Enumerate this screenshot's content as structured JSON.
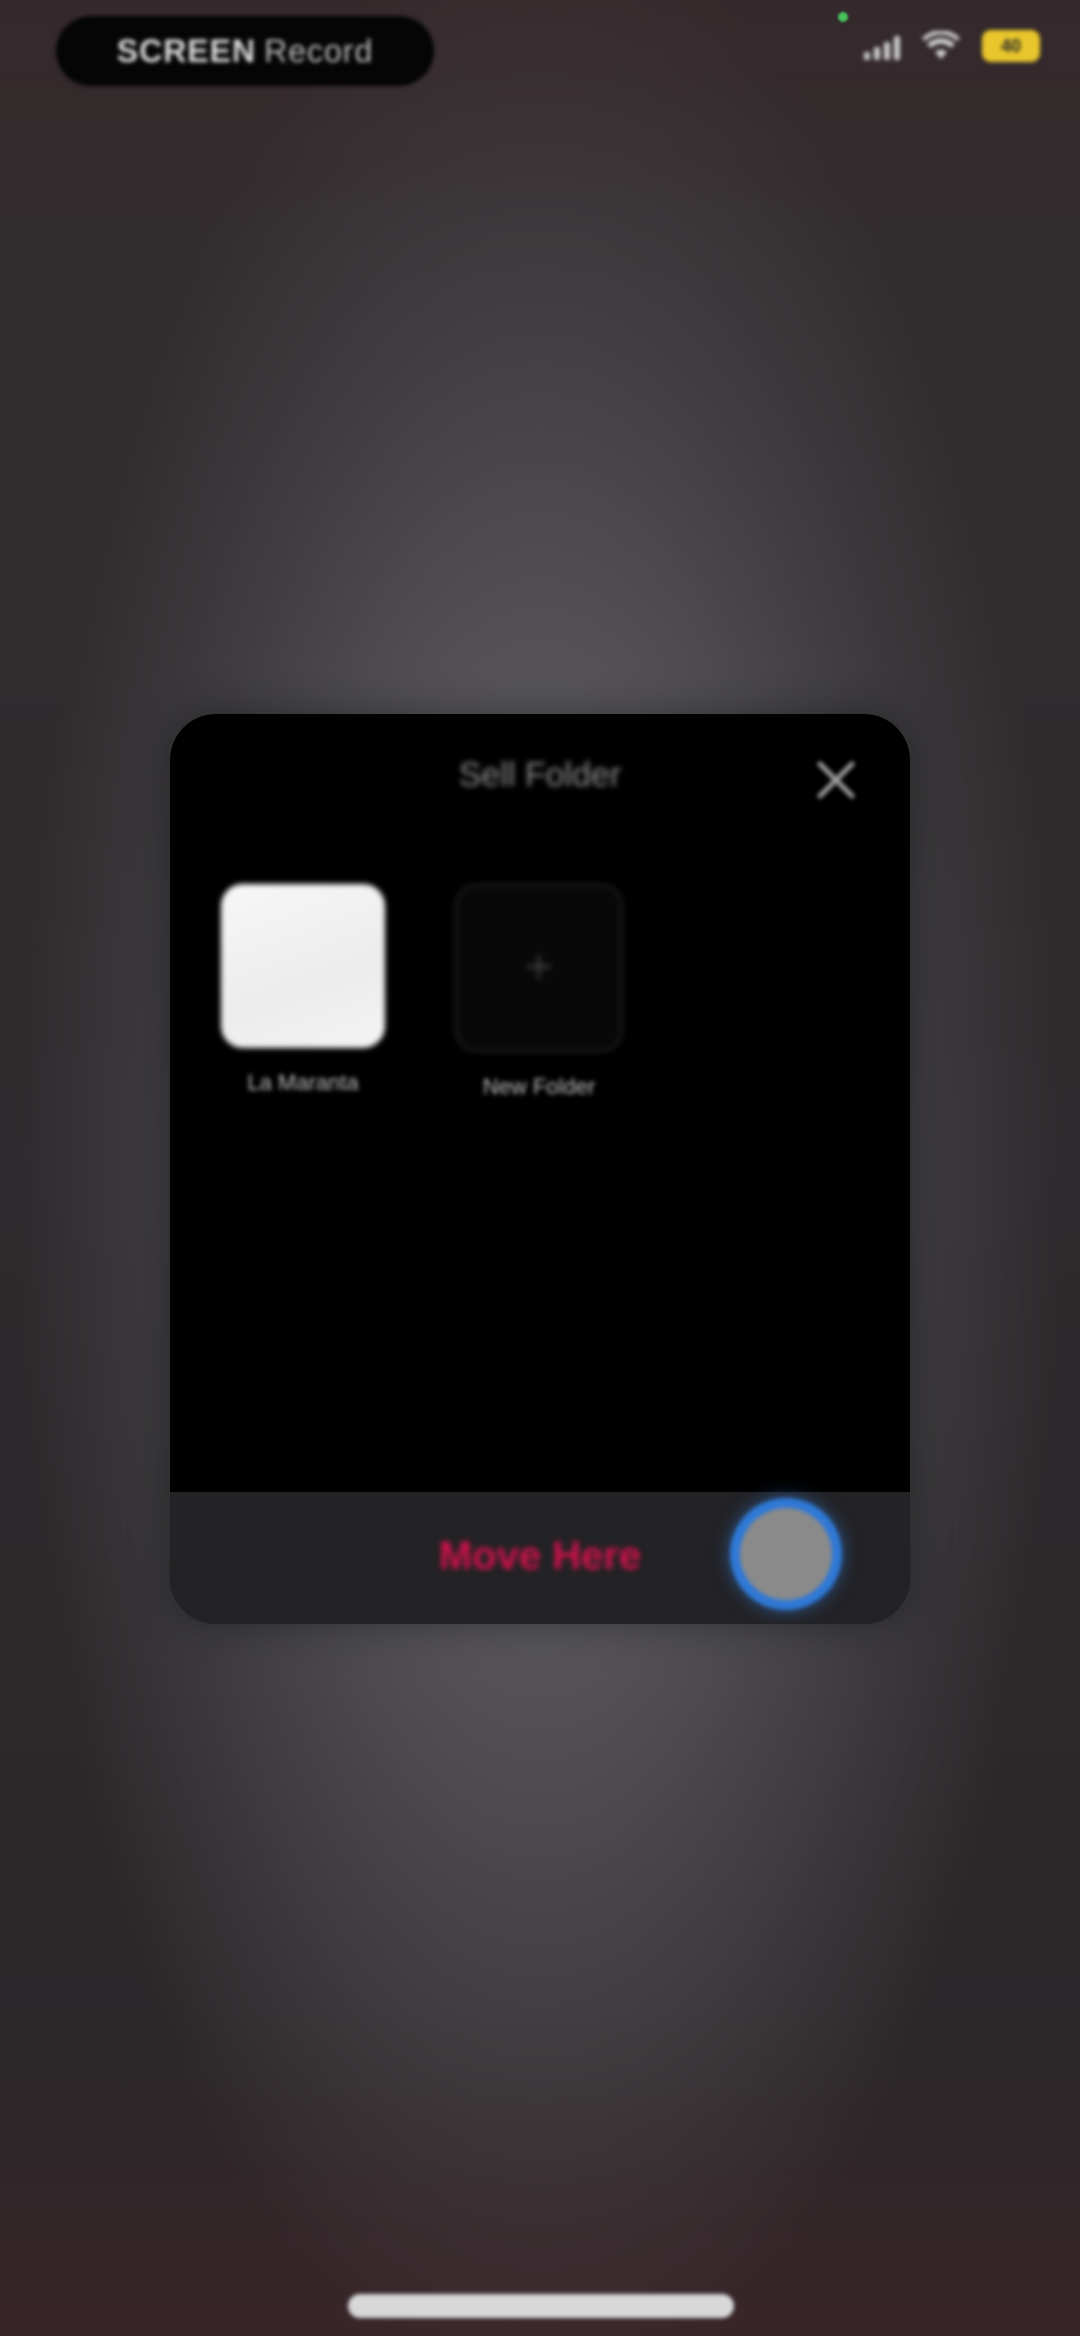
{
  "status_bar": {
    "recording_label_bold": "SCREEN",
    "recording_label_thin": "Record",
    "battery": "40"
  },
  "dialog": {
    "title": "Sell Folder",
    "close_icon": "close-icon",
    "folders": [
      {
        "label": "La Maranta",
        "icon": "folder-thumbnail"
      },
      {
        "label": "New Folder",
        "icon": "plus-icon"
      }
    ],
    "primary_action": "Move Here",
    "accent_color": "#d1124c"
  },
  "touch_indicator_color": "#2f79d6"
}
